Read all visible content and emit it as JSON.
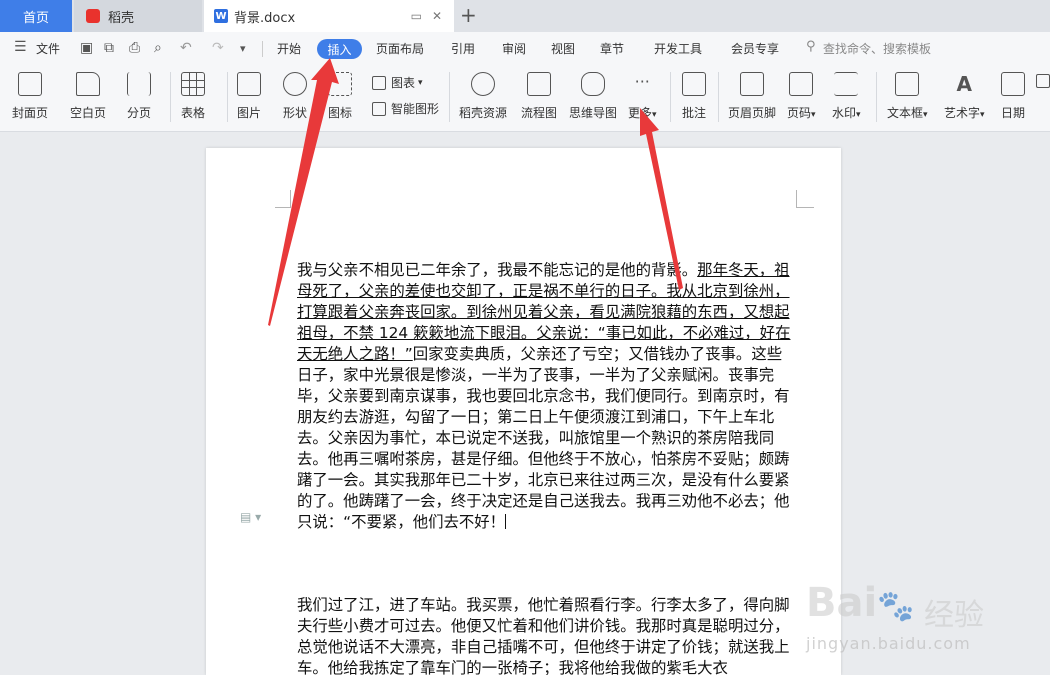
{
  "tabs": {
    "home": "首页",
    "daoke": "稻壳",
    "doc_title": "背景.docx",
    "doc_icon": "W"
  },
  "menu": {
    "file": "文件",
    "items": [
      "开始",
      "插入",
      "页面布局",
      "引用",
      "审阅",
      "视图",
      "章节",
      "开发工具",
      "会员专享"
    ],
    "active": "插入",
    "search_placeholder": "查找命令、搜索模板"
  },
  "ribbon": {
    "cover": "封面页",
    "blank": "空白页",
    "pagebreak": "分页",
    "table": "表格",
    "picture": "图片",
    "shape": "形状",
    "icon": "图标",
    "chart": "图表",
    "smartart": "智能图形",
    "daoke_res": "稻壳资源",
    "flowchart": "流程图",
    "mindmap": "思维导图",
    "more": "更多",
    "comment": "批注",
    "header_footer": "页眉页脚",
    "page_num": "页码",
    "watermark": "水印",
    "textbox": "文本框",
    "wordart": "艺术字",
    "date": "日期"
  },
  "document": {
    "p1_underlined": "那年冬天，祖母死了，父亲的差使也交卸了，正是祸不单行的日子。我从北京到徐州，打算跟着父亲奔丧回家。到徐州见着父亲，看见满院狼藉的东西，又想起祖母，不禁 124 簌簌地流下眼泪。父亲说：“事已如此，不必难过，好在天无绝人之路！”",
    "p1_start": "我与父亲不相见已二年余了，我最不能忘记的是他的背影。",
    "p1_rest": "回家变卖典质，父亲还了亏空；又借钱办了丧事。这些日子，家中光景很是惨淡，一半为了丧事，一半为了父亲赋闲。丧事完毕，父亲要到南京谋事，我也要回北京念书，我们便同行。到南京时，有朋友约去游逛，勾留了一日；第二日上午便须渡江到浦口，下午上车北去。父亲因为事忙，本已说定不送我，叫旅馆里一个熟识的茶房陪我同去。他再三嘱咐茶房，甚是仔细。但他终于不放心，怕茶房不妥贴；颇踌躇了一会。其实我那年已二十岁，北京已来往过两三次，是没有什么要紧的了。他踌躇了一会，终于决定还是自己送我去。我再三劝他不必去；他只说：“不要紧，他们去不好！",
    "p2": "我们过了江，进了车站。我买票，他忙着照看行李。行李太多了，得向脚夫行些小费才可过去。他便又忙着和他们讲价钱。我那时真是聪明过分，总觉他说话不大漂亮，非自己插嘴不可，但他终于讲定了价钱；就送我上车。他给我拣定了靠车门的一张椅子；我将他给我做的紫毛大衣"
  },
  "watermark": {
    "brand": "Bai",
    "brand2": "经验",
    "url": "jingyan.baidu.com"
  },
  "colors": {
    "accent": "#3f7ee8",
    "arrow": "#e8393a"
  }
}
